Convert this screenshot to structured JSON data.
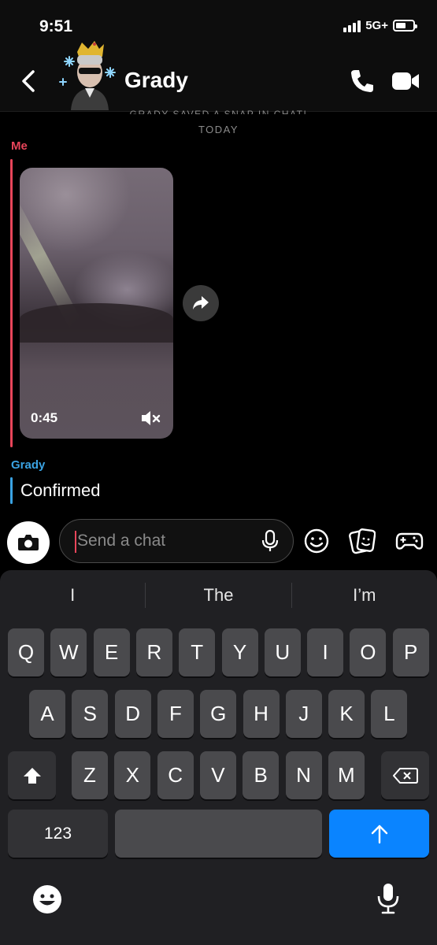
{
  "status_bar": {
    "time": "9:51",
    "network": "5G+",
    "battery_level": 0.6
  },
  "header": {
    "contact_name": "Grady",
    "icons": [
      "back-icon",
      "avatar",
      "phone-icon",
      "video-camera-icon"
    ]
  },
  "chat": {
    "saved_notice": "GRADY SAVED A SNAP IN CHAT!",
    "day_label": "TODAY",
    "messages": [
      {
        "sender": "Me",
        "type": "snap",
        "duration": "0:45",
        "muted": true
      },
      {
        "sender": "Grady",
        "type": "text",
        "text": "Confirmed"
      }
    ]
  },
  "input": {
    "placeholder": "Send a chat"
  },
  "keyboard": {
    "predictions": [
      "I",
      "The",
      "I’m"
    ],
    "rows": [
      [
        "Q",
        "W",
        "E",
        "R",
        "T",
        "Y",
        "U",
        "I",
        "O",
        "P"
      ],
      [
        "A",
        "S",
        "D",
        "F",
        "G",
        "H",
        "J",
        "K",
        "L"
      ],
      [
        "Z",
        "X",
        "C",
        "V",
        "B",
        "N",
        "M"
      ]
    ],
    "numbers_key": "123",
    "send_key_icon": "arrow-up-icon"
  },
  "colors": {
    "me": "#e8455a",
    "grady": "#3aa3e3",
    "send_key": "#0a84ff",
    "keyboard_bg": "#202023"
  }
}
